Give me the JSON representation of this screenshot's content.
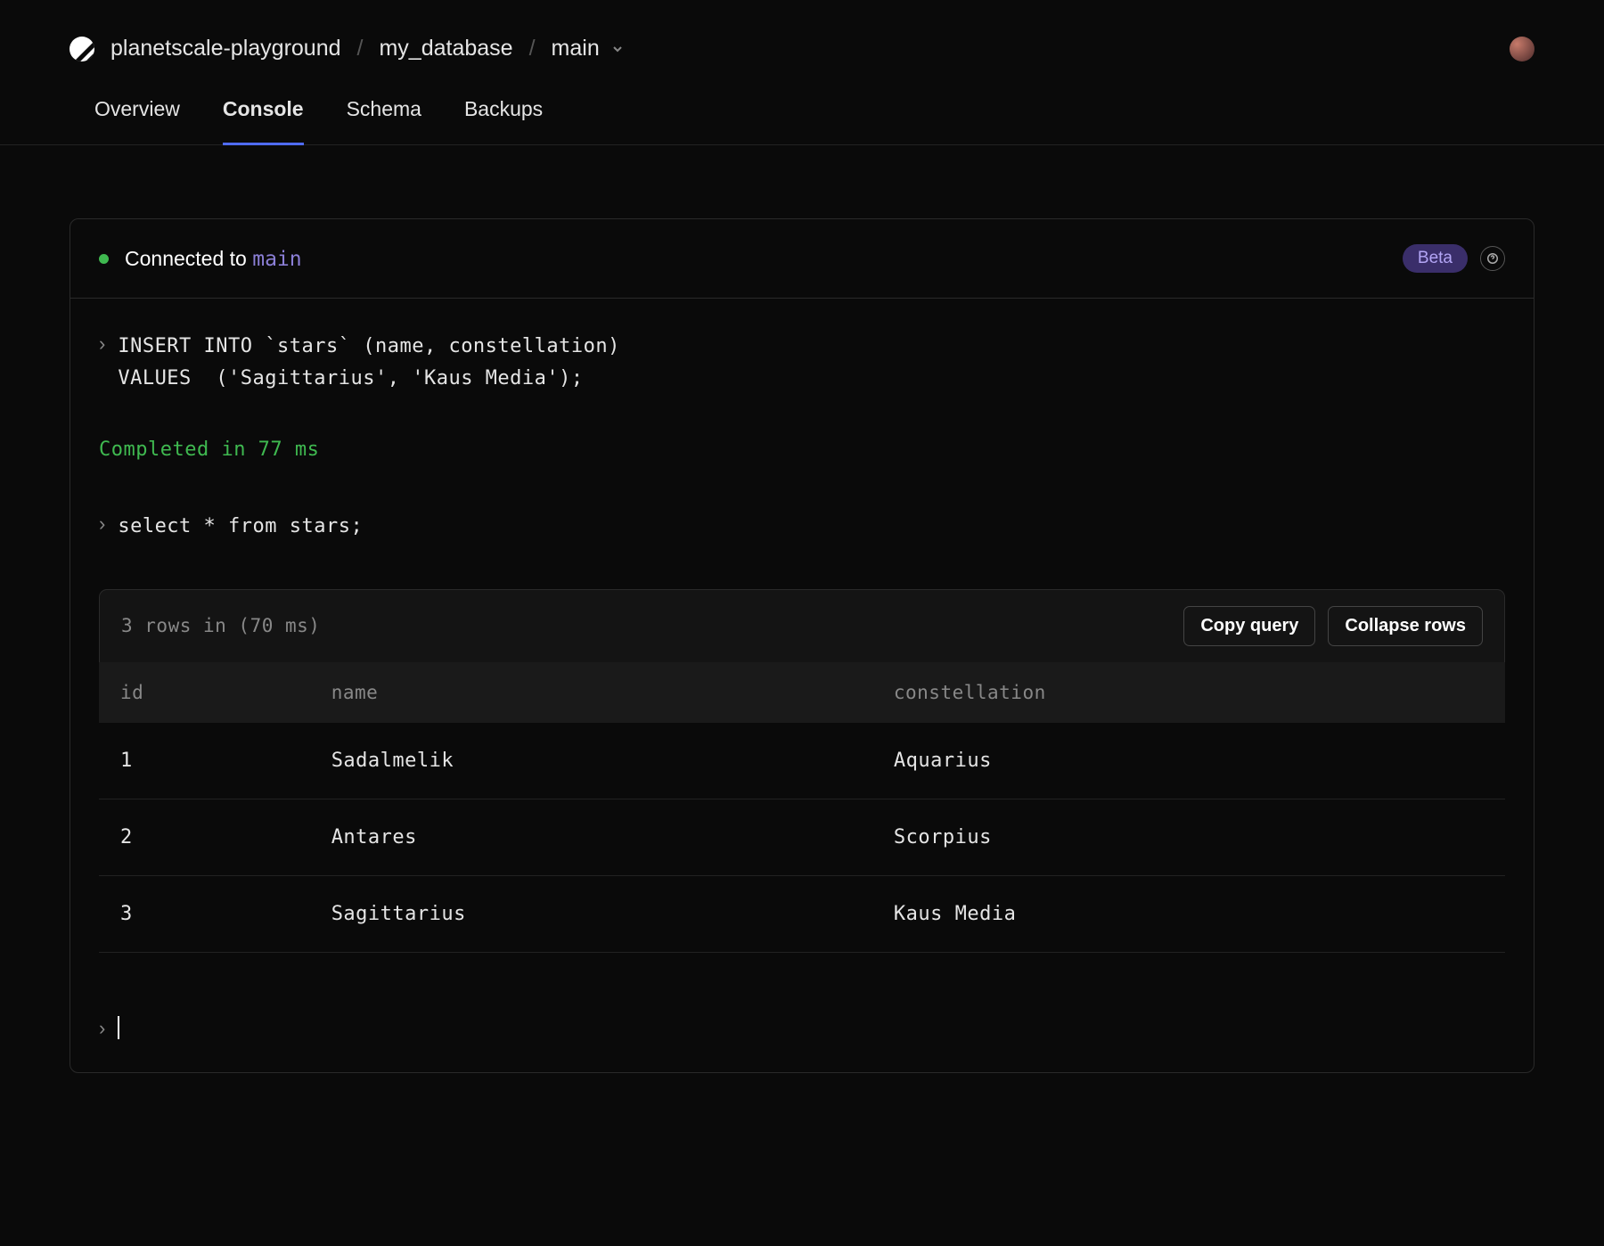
{
  "breadcrumb": {
    "org": "planetscale-playground",
    "database": "my_database",
    "branch": "main"
  },
  "tabs": [
    {
      "label": "Overview",
      "active": false
    },
    {
      "label": "Console",
      "active": true
    },
    {
      "label": "Schema",
      "active": false
    },
    {
      "label": "Backups",
      "active": false
    }
  ],
  "console": {
    "connected_label": "Connected to",
    "connected_branch": "main",
    "beta_label": "Beta",
    "query1": "INSERT INTO `stars` (name, constellation)\nVALUES  ('Sagittarius', 'Kaus Media');",
    "completion": "Completed in 77 ms",
    "query2": "select * from stars;",
    "result_summary": "3 rows in (70 ms)",
    "copy_btn": "Copy query",
    "collapse_btn": "Collapse rows",
    "columns": [
      "id",
      "name",
      "constellation"
    ],
    "rows": [
      {
        "id": "1",
        "name": "Sadalmelik",
        "constellation": "Aquarius"
      },
      {
        "id": "2",
        "name": "Antares",
        "constellation": "Scorpius"
      },
      {
        "id": "3",
        "name": "Sagittarius",
        "constellation": "Kaus Media"
      }
    ]
  }
}
